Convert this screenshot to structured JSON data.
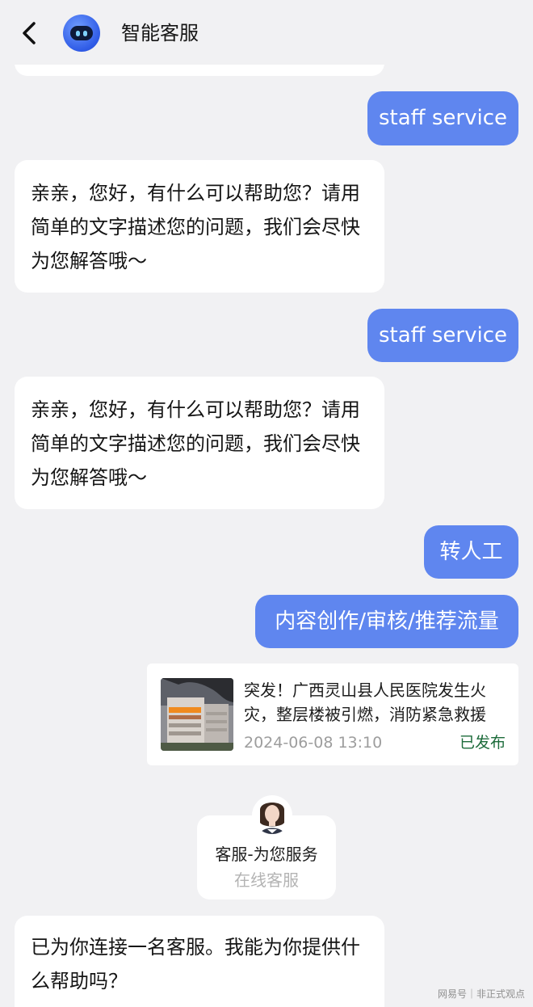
{
  "header": {
    "title": "智能客服",
    "back_icon": "chevron-left-icon",
    "avatar_icon": "robot-avatar-icon"
  },
  "messages": {
    "user_staff_1": "staff service",
    "bot_reply_1": "亲亲，您好，有什么可以帮助您？请用简单的文字描述您的问题，我们会尽快为您解答哦～",
    "user_staff_2": "staff service",
    "bot_reply_2": "亲亲，您好，有什么可以帮助您？请用简单的文字描述您的问题，我们会尽快为您解答哦～",
    "user_transfer": "转人工",
    "user_topic": "内容创作/审核/推荐流量"
  },
  "news_card": {
    "title": "突发！广西灵山县人民医院发生火灾，整层楼被引燃，消防紧急救援",
    "date": "2024-06-08 13:10",
    "status": "已发布"
  },
  "agent_card": {
    "name": "客服-为您服务",
    "subtitle": "在线客服"
  },
  "agent_message": "已为你连接一名客服。我能为你提供什么帮助吗？",
  "watermark": "网易号｜非正式观点",
  "colors": {
    "background": "#f1f1f3",
    "user_bubble": "#5f86ef",
    "bot_bubble": "#ffffff",
    "status": "#1c6b3a"
  }
}
